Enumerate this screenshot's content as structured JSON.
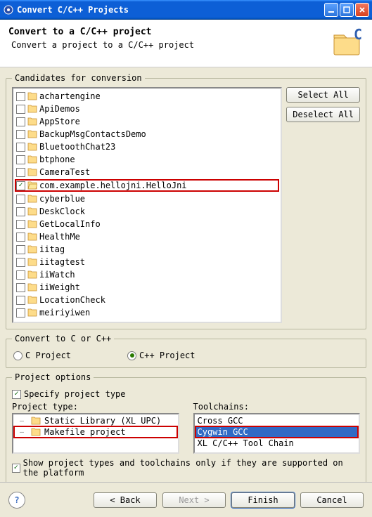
{
  "window": {
    "title": "Convert C/C++ Projects"
  },
  "header": {
    "title": "Convert to a C/C++ project",
    "desc": "Convert a project to a C/C++ project"
  },
  "candidates": {
    "legend": "Candidates for conversion",
    "select_all": "Select All",
    "deselect_all": "Deselect All",
    "items": [
      {
        "label": "achartengine",
        "checked": false,
        "hl": false
      },
      {
        "label": "ApiDemos",
        "checked": false,
        "hl": false
      },
      {
        "label": "AppStore",
        "checked": false,
        "hl": false
      },
      {
        "label": "BackupMsgContactsDemo",
        "checked": false,
        "hl": false
      },
      {
        "label": "BluetoothChat23",
        "checked": false,
        "hl": false
      },
      {
        "label": "btphone",
        "checked": false,
        "hl": false
      },
      {
        "label": "CameraTest",
        "checked": false,
        "hl": false
      },
      {
        "label": "com.example.hellojni.HelloJni",
        "checked": true,
        "hl": true
      },
      {
        "label": "cyberblue",
        "checked": false,
        "hl": false
      },
      {
        "label": "DeskClock",
        "checked": false,
        "hl": false
      },
      {
        "label": "GetLocalInfo",
        "checked": false,
        "hl": false
      },
      {
        "label": "HealthMe",
        "checked": false,
        "hl": false
      },
      {
        "label": "iitag",
        "checked": false,
        "hl": false
      },
      {
        "label": "iitagtest",
        "checked": false,
        "hl": false
      },
      {
        "label": "iiWatch",
        "checked": false,
        "hl": false
      },
      {
        "label": "iiWeight",
        "checked": false,
        "hl": false
      },
      {
        "label": "LocationCheck",
        "checked": false,
        "hl": false
      },
      {
        "label": "meiriyiwen",
        "checked": false,
        "hl": false
      }
    ]
  },
  "convert_to": {
    "legend": "Convert to C or C++",
    "c_label": "C Project",
    "cpp_label": "C++ Project",
    "selected": "cpp"
  },
  "project_options": {
    "legend": "Project options",
    "specify_label": "Specify project type",
    "specify_checked": true,
    "type_label": "Project type:",
    "toolchains_label": "Toolchains:",
    "types": [
      {
        "label": "Static Library (XL UPC)",
        "branch": "–",
        "hl": false
      },
      {
        "label": "Makefile project",
        "branch": "–",
        "hl": true
      }
    ],
    "toolchains": [
      {
        "label": "Cross GCC",
        "selected": false
      },
      {
        "label": "Cygwin GCC",
        "selected": true
      },
      {
        "label": "XL C/C++ Tool Chain",
        "selected": false
      }
    ],
    "supported_label": "Show project types and toolchains only if they are supported on the platform",
    "supported_checked": true
  },
  "footer": {
    "back": "< Back",
    "next": "Next >",
    "finish": "Finish",
    "cancel": "Cancel"
  }
}
